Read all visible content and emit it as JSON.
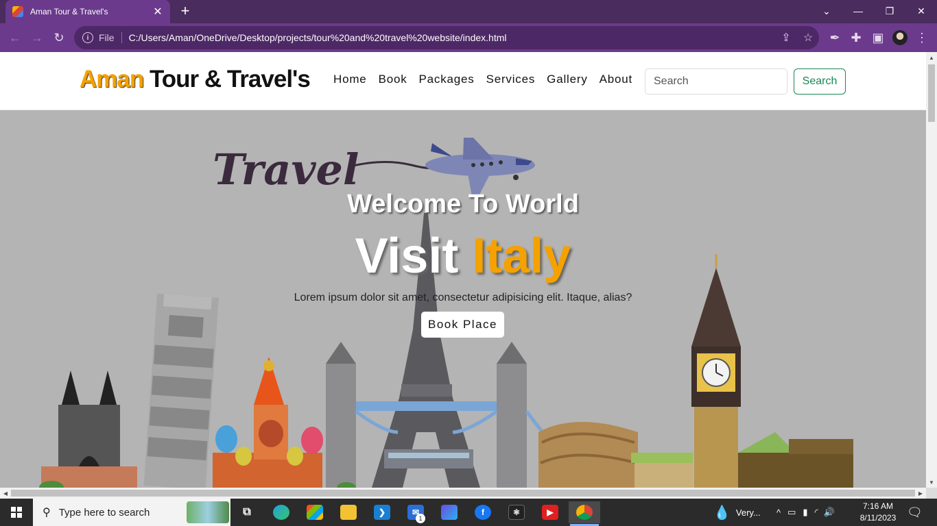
{
  "browser": {
    "tab_title": "Aman Tour & Travel's",
    "new_tab_icon": "+",
    "url_scheme_label": "File",
    "url": "C:/Users/Aman/OneDrive/Desktop/projects/tour%20and%20travel%20website/index.html",
    "accent_color": "#6b3a8c"
  },
  "navbar": {
    "brand_first": "Aman",
    "brand_rest": " Tour & Travel's",
    "links": [
      "Home",
      "Book",
      "Packages",
      "Services",
      "Gallery",
      "About"
    ],
    "search_placeholder": "Search",
    "search_button": "Search"
  },
  "hero": {
    "logo_text": "Travel",
    "welcome": "Welcome To World",
    "visit_word": "Visit",
    "destination": "Italy",
    "description": "Lorem ipsum dolor sit amet, consectetur adipisicing elit. Itaque, alias?",
    "cta": "Book Place",
    "accent_color": "#f5a100"
  },
  "taskbar": {
    "search_placeholder": "Type here to search",
    "weather": "Very...",
    "mail_badge": "1",
    "time": "7:16 AM",
    "date": "8/11/2023"
  }
}
